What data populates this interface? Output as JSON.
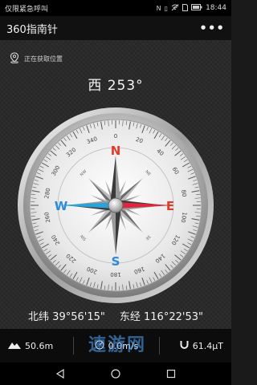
{
  "status_bar": {
    "left_text": "仅限紧急呼叫",
    "time": "18:44"
  },
  "app_bar": {
    "title": "360指南针",
    "more_icon": "more-dots-icon"
  },
  "location": {
    "status": "正在获取位置",
    "icon": "location-pin-icon"
  },
  "heading": {
    "direction": "西",
    "degrees": "253°"
  },
  "compass": {
    "cardinals": {
      "N": "N",
      "E": "E",
      "S": "S",
      "W": "W"
    },
    "intercardinals": [
      "NE",
      "SE",
      "SW",
      "NW"
    ],
    "numbers": [
      "0",
      "20",
      "40",
      "60",
      "80",
      "100",
      "120",
      "140",
      "160",
      "180",
      "200",
      "220",
      "240",
      "260",
      "280",
      "300",
      "320",
      "340"
    ],
    "needle_bearing_deg": 90,
    "colors": {
      "north": "#e23b2a",
      "east": "#e23b2a",
      "west": "#2f8ad8",
      "south": "#2f8ad8",
      "needle_red": "#e0263a",
      "needle_blue": "#2aa3d8"
    }
  },
  "coordinates": {
    "latitude_label": "北纬",
    "latitude": "39°56'15\"",
    "longitude_label": "东经",
    "longitude": "116°22'53\""
  },
  "bottom_bar": {
    "altitude": "50.6m",
    "speed": "0.0m/s",
    "magnetic": "61.4μT"
  },
  "watermark": "速游网"
}
